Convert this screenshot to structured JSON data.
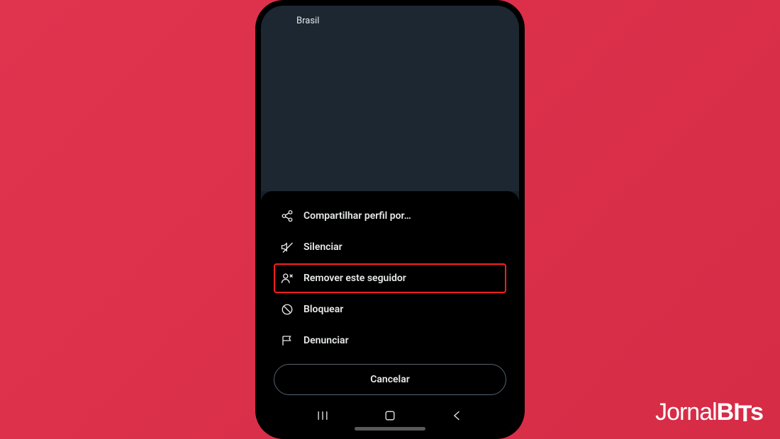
{
  "profile": {
    "location": "Brasil"
  },
  "actionSheet": {
    "items": [
      {
        "icon": "share",
        "label": "Compartilhar perfil por…",
        "highlighted": false
      },
      {
        "icon": "mute",
        "label": "Silenciar",
        "highlighted": false
      },
      {
        "icon": "removeFollower",
        "label": "Remover este seguidor",
        "highlighted": true
      },
      {
        "icon": "block",
        "label": "Bloquear",
        "highlighted": false
      },
      {
        "icon": "report",
        "label": "Denunciar",
        "highlighted": false
      }
    ],
    "cancel": "Cancelar"
  },
  "watermark": {
    "part1": "Jornal",
    "part2": "BI",
    "part3": "T",
    "part4": "s"
  }
}
